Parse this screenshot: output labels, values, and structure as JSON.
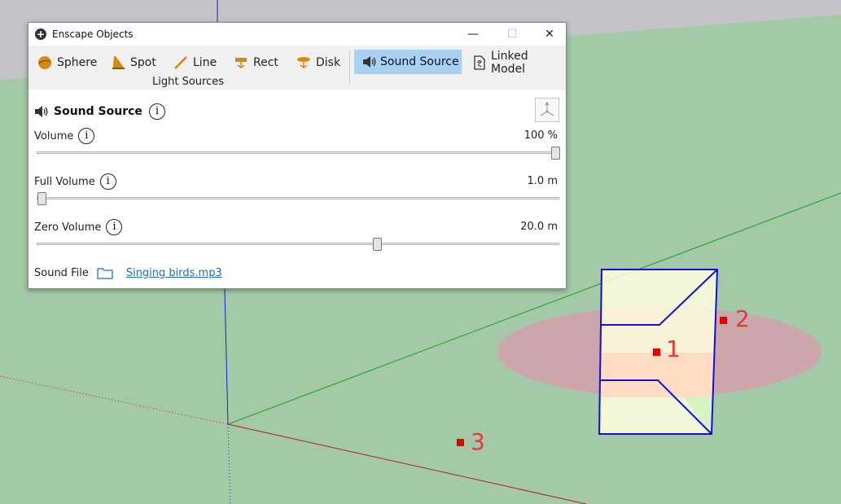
{
  "window": {
    "title": "Enscape Objects",
    "controls": {
      "minimize": "—",
      "maximize": "☐",
      "close": "✕"
    }
  },
  "toolbar": {
    "items": [
      {
        "label": "Sphere",
        "icon": "sphere-light-icon"
      },
      {
        "label": "Spot",
        "icon": "spot-light-icon"
      },
      {
        "label": "Line",
        "icon": "line-light-icon"
      },
      {
        "label": "Rect",
        "icon": "rect-light-icon"
      },
      {
        "label": "Disk",
        "icon": "disk-light-icon"
      }
    ],
    "group_label": "Light Sources",
    "sound_source": {
      "label": "Sound Source",
      "icon": "speaker-icon",
      "selected": true
    },
    "linked_model": {
      "label": "Linked Model",
      "icon": "linked-model-icon"
    }
  },
  "panel": {
    "title": "Sound Source",
    "info_glyph": "i",
    "volume": {
      "label": "Volume",
      "value": "100 %",
      "level_fraction": 1.0
    },
    "full_volume": {
      "label": "Full Volume",
      "value": "1.0 m",
      "level_fraction": 0.0
    },
    "zero_volume": {
      "label": "Zero Volume",
      "value": "20.0 m",
      "level_fraction": 0.65
    },
    "sound_file": {
      "label": "Sound File",
      "file_name": "Singing birds.mp3"
    }
  },
  "viewport": {
    "markers": [
      "1",
      "2",
      "3"
    ],
    "colors": {
      "ground": "#a3c9a7",
      "sky": "#c4c4c8",
      "range_ellipse": "#cfa3ad",
      "speaker_outline": "#1010d8",
      "marker": "#e40000"
    }
  }
}
